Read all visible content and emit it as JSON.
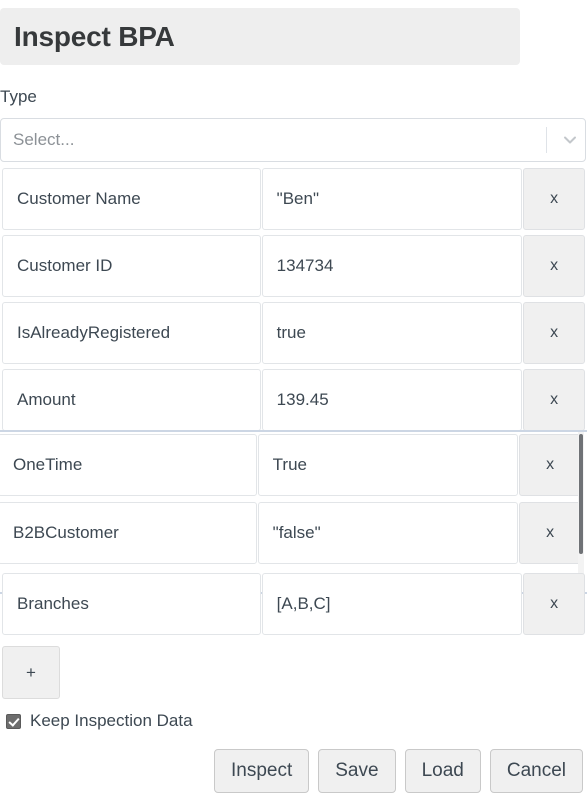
{
  "header": {
    "title": "Inspect BPA"
  },
  "type_field": {
    "label": "Type",
    "placeholder": "Select...",
    "value": "",
    "arrow_icon": "chevron-down-icon"
  },
  "rows": [
    {
      "key": "Customer Name",
      "value": "\"Ben\"",
      "delete_label": "x"
    },
    {
      "key": "Customer ID",
      "value": "134734",
      "delete_label": "x"
    },
    {
      "key": "IsAlreadyRegistered",
      "value": "true",
      "delete_label": "x"
    },
    {
      "key": "Amount",
      "value": "139.45",
      "delete_label": "x"
    },
    {
      "key": "OneTime",
      "value": "True",
      "delete_label": "x"
    },
    {
      "key": "B2BCustomer",
      "value": "\"false\"",
      "delete_label": "x"
    },
    {
      "key": "Branches",
      "value": "[A,B,C]",
      "delete_label": "x"
    }
  ],
  "add_button": {
    "label": "+"
  },
  "keep_inspection": {
    "label": "Keep Inspection Data",
    "checked": true
  },
  "footer": {
    "inspect_label": "Inspect",
    "save_label": "Save",
    "load_label": "Load",
    "cancel_label": "Cancel"
  },
  "colors": {
    "title_bg": "#eeeeee",
    "text": "#3d4852",
    "button_bg": "#f0f0f0",
    "border": "#e2e5e8",
    "scroll_divider": "#ccd6e4",
    "placeholder": "#8c9196"
  }
}
